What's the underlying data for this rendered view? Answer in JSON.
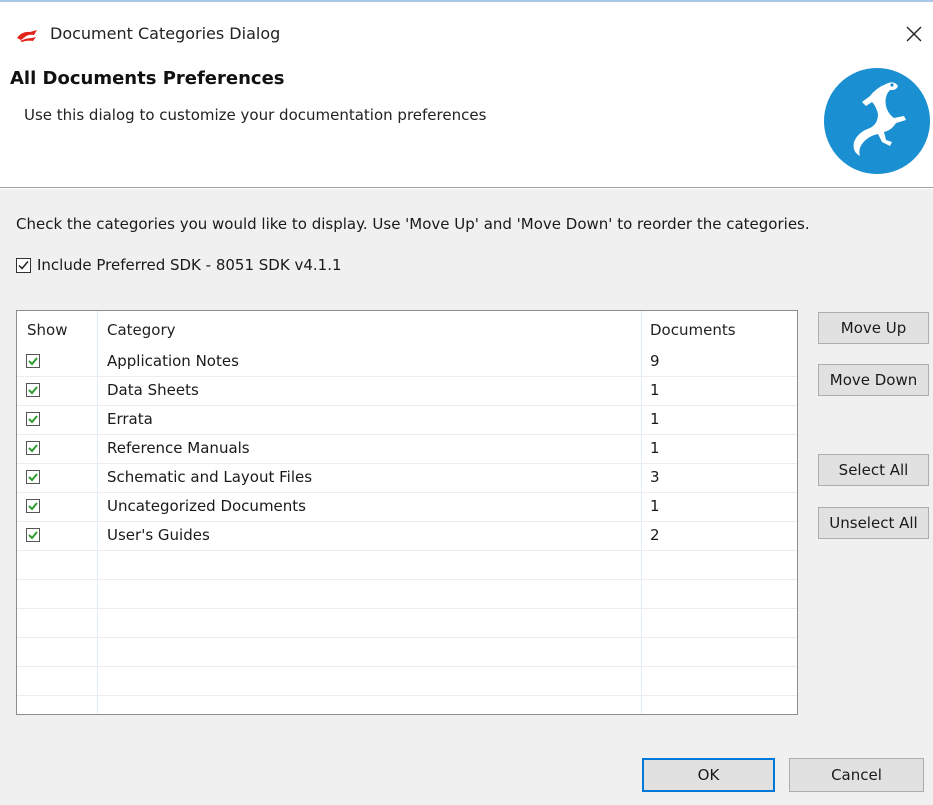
{
  "window": {
    "title": "Document Categories Dialog",
    "accent_color": "#0078d7"
  },
  "header": {
    "title": "All Documents Preferences",
    "subtitle": "Use this dialog to customize your documentation preferences",
    "logo_color": "#1a8fd1"
  },
  "body": {
    "instruction": "Check the categories you would like to display.  Use 'Move Up' and 'Move Down' to reorder the categories.",
    "include_sdk": {
      "label": "Include Preferred SDK - 8051 SDK v4.1.1",
      "checked": true
    }
  },
  "table": {
    "columns": [
      "Show",
      "Category",
      "Documents"
    ],
    "rows": [
      {
        "show": true,
        "category": "Application Notes",
        "documents": "9"
      },
      {
        "show": true,
        "category": "Data Sheets",
        "documents": "1"
      },
      {
        "show": true,
        "category": "Errata",
        "documents": "1"
      },
      {
        "show": true,
        "category": "Reference Manuals",
        "documents": "1"
      },
      {
        "show": true,
        "category": "Schematic and Layout Files",
        "documents": "3"
      },
      {
        "show": true,
        "category": "Uncategorized Documents",
        "documents": "1"
      },
      {
        "show": true,
        "category": "User's Guides",
        "documents": "2"
      }
    ],
    "check_color": "#2e9c2e"
  },
  "side_buttons": {
    "move_up": "Move Up",
    "move_down": "Move Down",
    "select_all": "Select All",
    "unselect_all": "Unselect All"
  },
  "footer": {
    "ok": "OK",
    "cancel": "Cancel"
  }
}
